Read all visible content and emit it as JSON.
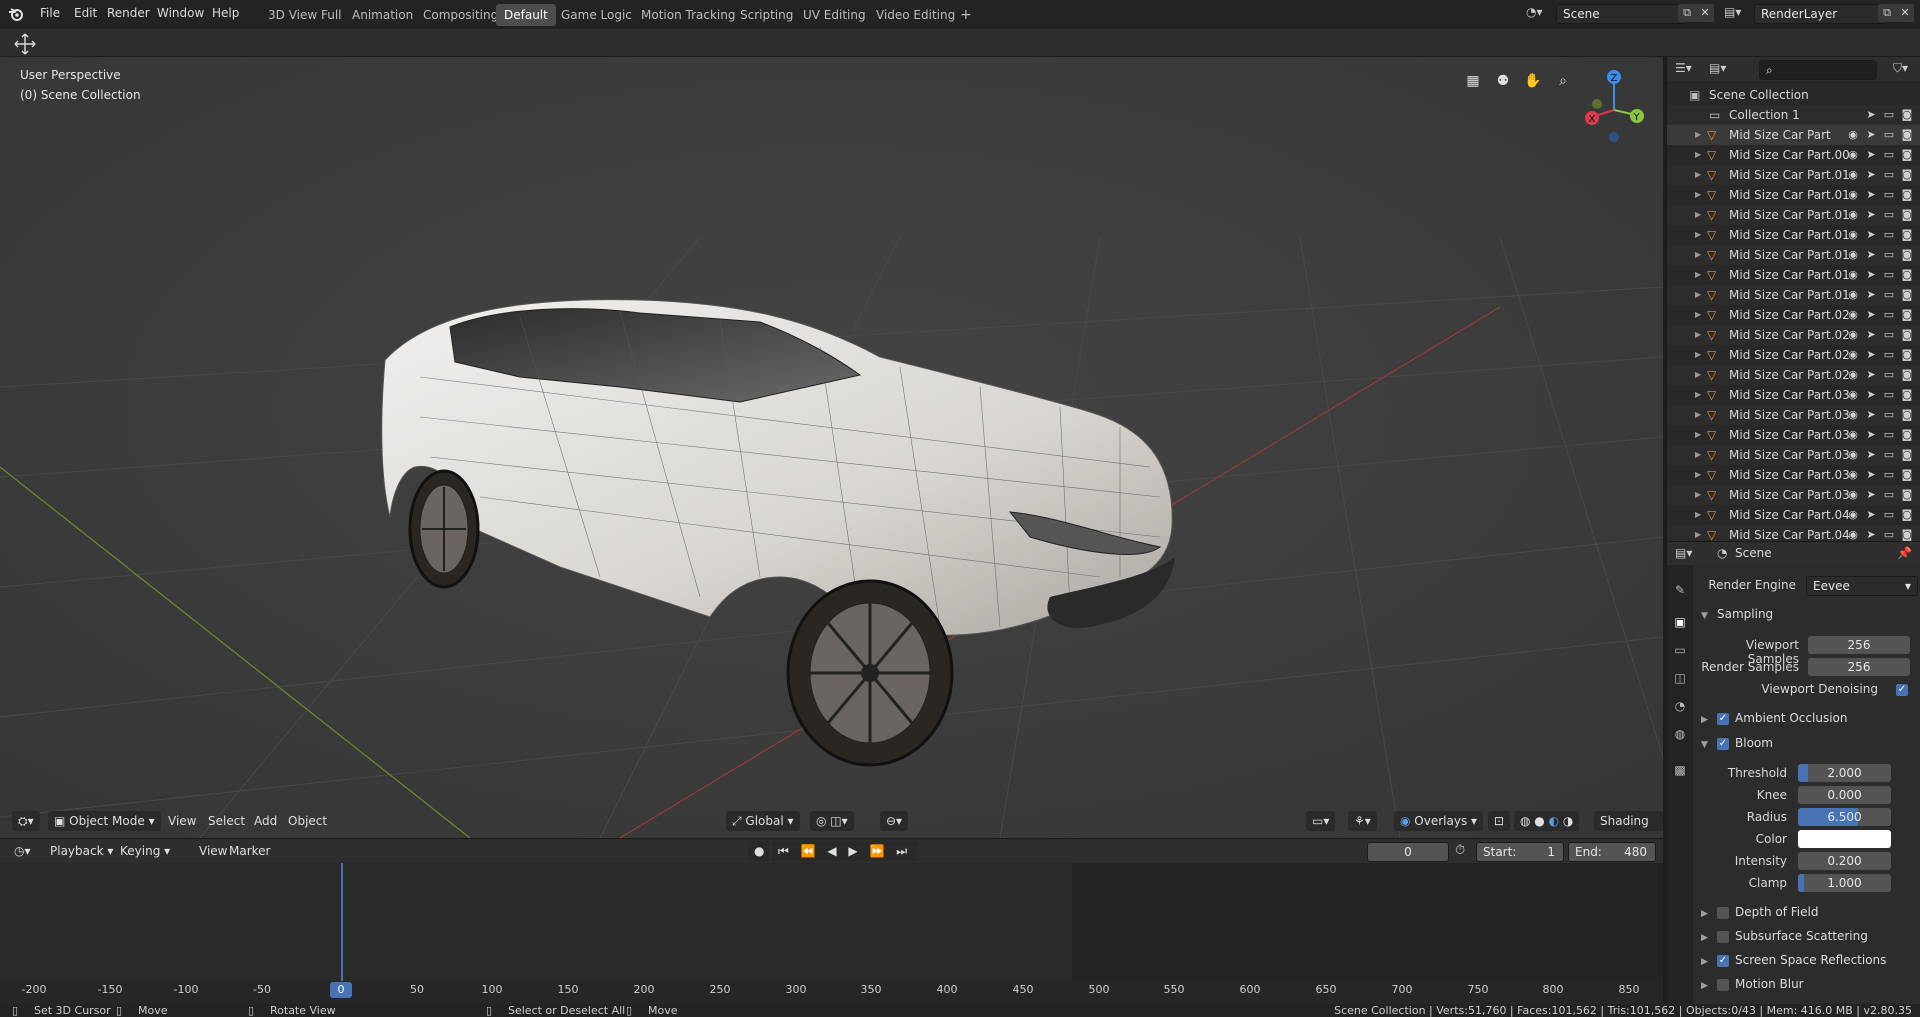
{
  "menu": [
    "File",
    "Edit",
    "Render",
    "Window",
    "Help"
  ],
  "workspaces": [
    "3D View Full",
    "Animation",
    "Compositing",
    "Default",
    "Game Logic",
    "Motion Tracking",
    "Scripting",
    "UV Editing",
    "Video Editing"
  ],
  "active_workspace": "Default",
  "scene_name": "Scene",
  "view_layer_name": "RenderLayer",
  "viewport": {
    "perspective_label": "User Perspective",
    "collection_label": "(0) Scene Collection",
    "mode": "Object Mode",
    "menus": [
      "View",
      "Select",
      "Add",
      "Object"
    ],
    "orientation": "Global",
    "overlays_label": "Overlays",
    "shading_label": "Shading",
    "gizmo": {
      "x": "X",
      "y": "Y",
      "z": "Z"
    }
  },
  "timeline": {
    "playback_label": "Playback",
    "keying_label": "Keying",
    "view_label": "View",
    "marker_label": "Marker",
    "current_frame": "0",
    "start_label": "Start:",
    "start_value": "1",
    "end_label": "End:",
    "end_value": "480",
    "ticks": [
      "-200",
      "-150",
      "-100",
      "-50",
      "0",
      "50",
      "100",
      "150",
      "200",
      "250",
      "300",
      "350",
      "400",
      "450",
      "500",
      "550",
      "600",
      "650",
      "700",
      "750",
      "800",
      "850"
    ]
  },
  "outliner": {
    "root": "Scene Collection",
    "collection": "Collection 1",
    "items": [
      "Mid Size Car Part",
      "Mid Size Car Part.00",
      "Mid Size Car Part.01",
      "Mid Size Car Part.01",
      "Mid Size Car Part.01",
      "Mid Size Car Part.01",
      "Mid Size Car Part.01",
      "Mid Size Car Part.01",
      "Mid Size Car Part.01",
      "Mid Size Car Part.02",
      "Mid Size Car Part.02",
      "Mid Size Car Part.02",
      "Mid Size Car Part.02",
      "Mid Size Car Part.03",
      "Mid Size Car Part.03",
      "Mid Size Car Part.03",
      "Mid Size Car Part.03",
      "Mid Size Car Part.03",
      "Mid Size Car Part.03",
      "Mid Size Car Part.04",
      "Mid Size Car Part.04"
    ]
  },
  "properties": {
    "context": "Scene",
    "render_engine_label": "Render Engine",
    "render_engine": "Eevee",
    "sampling": "Sampling",
    "viewport_samples_label": "Viewport Samples",
    "viewport_samples": "256",
    "render_samples_label": "Render Samples",
    "render_samples": "256",
    "viewport_denoising_label": "Viewport Denoising",
    "ambient_occlusion": "Ambient Occlusion",
    "bloom": "Bloom",
    "threshold_label": "Threshold",
    "threshold": "2.000",
    "knee_label": "Knee",
    "knee": "0.000",
    "radius_label": "Radius",
    "radius": "6.500",
    "color_label": "Color",
    "intensity_label": "Intensity",
    "intensity": "0.200",
    "clamp_label": "Clamp",
    "clamp": "1.000",
    "depth_of_field": "Depth of Field",
    "subsurface": "Subsurface Scattering",
    "ssr": "Screen Space Reflections",
    "motion_blur": "Motion Blur"
  },
  "status": {
    "set_cursor": "Set 3D Cursor",
    "move": "Move",
    "rotate": "Rotate View",
    "select": "Select or Deselect All",
    "move2": "Move",
    "stats": "Scene Collection | Verts:51,760 | Faces:101,562 | Tris:101,562 | Objects:0/43 | Mem: 416.0 MB | v2.80.35"
  },
  "colors": {
    "accent": "#4772b3",
    "x_axis": "#d83a4c",
    "y_axis": "#8cc63e",
    "z_axis": "#3a8ee6",
    "mesh_icon": "#e8933a"
  }
}
